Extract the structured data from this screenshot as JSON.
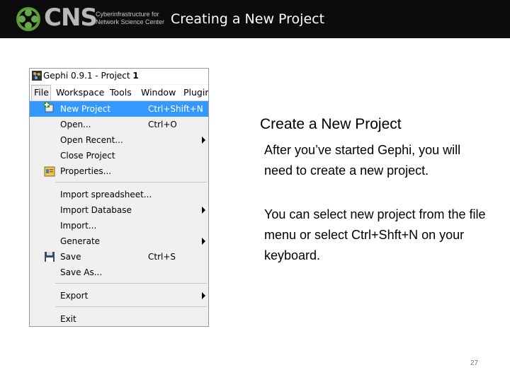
{
  "header": {
    "logo_text": "CNS",
    "logo_sub_line1": "Cyberinfrastructure for",
    "logo_sub_line2": "Network Science Center",
    "title": "Creating a New Project"
  },
  "window": {
    "title_prefix": "Gephi 0.9.1 - Project ",
    "title_suffix": "1",
    "menubar": [
      "File",
      "Workspace",
      "Tools",
      "Window",
      "Plugin"
    ],
    "menu": {
      "new_project": {
        "label": "New Project",
        "shortcut": "Ctrl+Shift+N"
      },
      "open": {
        "label": "Open...",
        "shortcut": "Ctrl+O"
      },
      "open_recent": {
        "label": "Open Recent..."
      },
      "close_project": {
        "label": "Close Project"
      },
      "properties": {
        "label": "Properties..."
      },
      "import_spreadsheet": {
        "label": "Import spreadsheet..."
      },
      "import_database": {
        "label": "Import Database"
      },
      "import": {
        "label": "Import..."
      },
      "generate": {
        "label": "Generate"
      },
      "save": {
        "label": "Save",
        "shortcut": "Ctrl+S"
      },
      "save_as": {
        "label": "Save As..."
      },
      "export": {
        "label": "Export"
      },
      "exit": {
        "label": "Exit"
      }
    }
  },
  "content": {
    "title": "Create a New Project",
    "para1": "After you’ve started Gephi, you will need to create a new project.",
    "para2": "You can select new project from the file menu or select Ctrl+Shft+N on your keyboard."
  },
  "page_number": "27",
  "colors": {
    "header_bg": "#0c0c0c",
    "menu_highlight": "#3399ff",
    "logo_green": "#6aa84f"
  }
}
